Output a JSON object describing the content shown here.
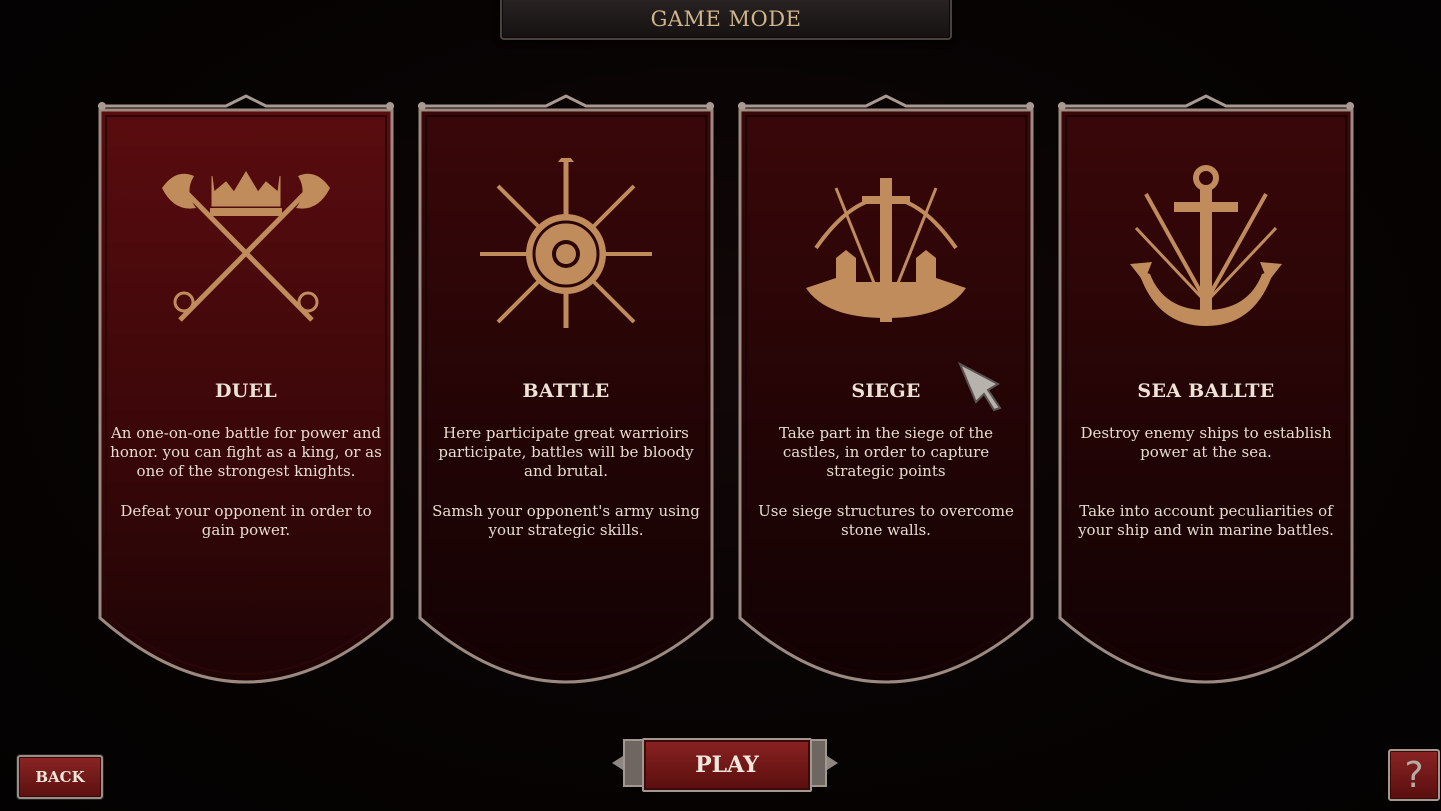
{
  "header": {
    "title": "GAME MODE"
  },
  "modes": [
    {
      "key": "duel",
      "title": "DUEL",
      "desc1": "An one-on-one battle for power and honor. you can fight as a king, or as one of the strongest knights.",
      "desc2": "Defeat your opponent in order to gain power.",
      "icon": "crossed-axes-crown-icon"
    },
    {
      "key": "battle",
      "title": "BATTLE",
      "desc1": "Here participate great warrioirs participate, battles will be bloody and brutal.",
      "desc2": "Samsh your opponent's army using your strategic skills.",
      "icon": "shield-spears-icon"
    },
    {
      "key": "siege",
      "title": "SIEGE",
      "desc1": "Take part in the siege of the castles, in order to capture strategic points",
      "desc2": "Use siege structures to overcome stone walls.",
      "icon": "siege-tower-icon"
    },
    {
      "key": "sea",
      "title": "SEA BALLTE",
      "desc1": "Destroy enemy ships to establish power at the sea.",
      "desc2": "Take into account peculiarities of your ship and win marine battles.",
      "icon": "anchor-spears-icon"
    }
  ],
  "buttons": {
    "back": "BACK",
    "play": "PLAY",
    "help": "?"
  },
  "colors": {
    "banner_dark": "#1e0506",
    "banner_light": "#4a0c0e",
    "frame": "#9c8a80",
    "gold": "#c89462",
    "accent_text": "#d2b48a"
  }
}
